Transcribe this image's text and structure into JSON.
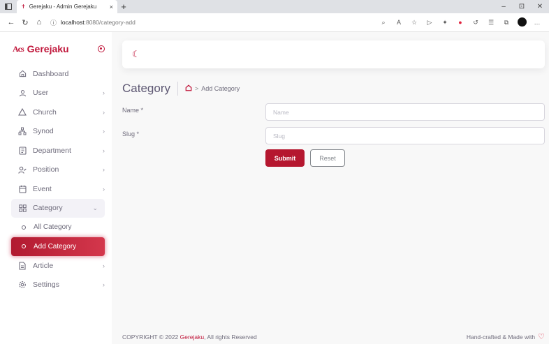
{
  "browser": {
    "tab_title": "Gerejaku - Admin Gerejaku",
    "tab_close": "×",
    "new_tab": "+",
    "url_host": "localhost",
    "url_path": ":8080/category-add",
    "window_controls": [
      "–",
      "⊡",
      "✕"
    ]
  },
  "sidebar": {
    "brand_logo_text": "Acs",
    "brand_name": "Gerejaku",
    "items": [
      {
        "label": "Dashboard",
        "icon": "home-icon",
        "chevron": ""
      },
      {
        "label": "User",
        "icon": "user-icon",
        "chevron": "›"
      },
      {
        "label": "Church",
        "icon": "triangle-icon",
        "chevron": "›"
      },
      {
        "label": "Synod",
        "icon": "network-icon",
        "chevron": "›"
      },
      {
        "label": "Department",
        "icon": "building-icon",
        "chevron": "›"
      },
      {
        "label": "Position",
        "icon": "user-check-icon",
        "chevron": "›"
      },
      {
        "label": "Event",
        "icon": "calendar-icon",
        "chevron": "›"
      },
      {
        "label": "Category",
        "icon": "grid-icon",
        "chevron": "⌄"
      }
    ],
    "subitems": [
      {
        "label": "All Category"
      },
      {
        "label": "Add Category"
      }
    ],
    "after_items": [
      {
        "label": "Article",
        "icon": "file-icon",
        "chevron": "›"
      },
      {
        "label": "Settings",
        "icon": "settings-icon",
        "chevron": "›"
      }
    ]
  },
  "header": {
    "title": "Category",
    "breadcrumb_sep": ">",
    "breadcrumb_current": "Add Category"
  },
  "form": {
    "name_label": "Name *",
    "name_placeholder": "Name",
    "slug_label": "Slug *",
    "slug_placeholder": "Slug",
    "submit_label": "Submit",
    "reset_label": "Reset"
  },
  "footer": {
    "copyright_prefix": "COPYRIGHT © 2022 ",
    "copyright_brand": "Gerejaku",
    "copyright_suffix": ", All rights Reserved",
    "right_text": "Hand-crafted & Made with"
  },
  "colors": {
    "accent": "#c0163a",
    "text": "#6e6b7b"
  }
}
